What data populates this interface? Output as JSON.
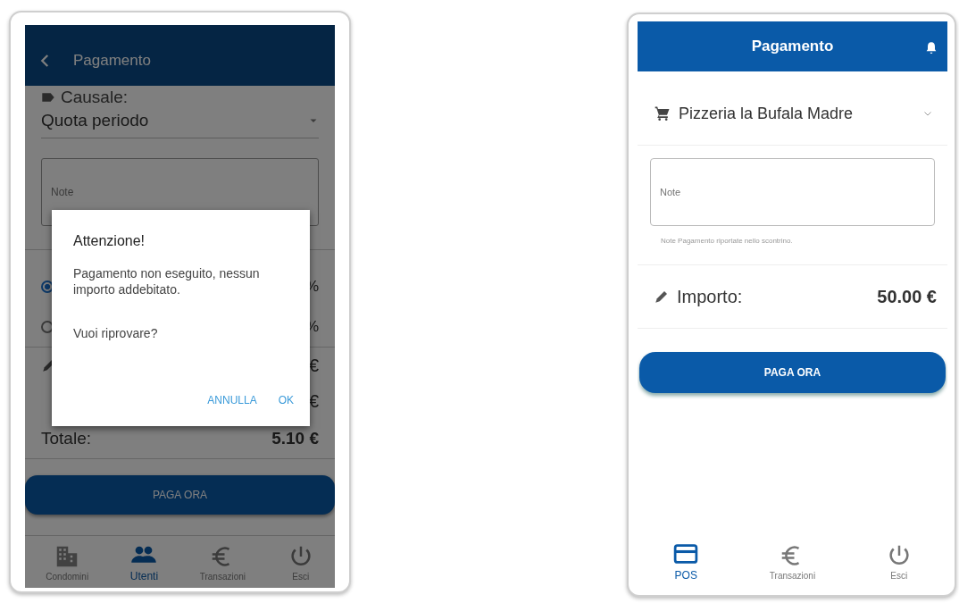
{
  "left_screen": {
    "header": {
      "title": "Pagamento"
    },
    "causale": {
      "label": "Causale:",
      "value": "Quota periodo"
    },
    "note": {
      "placeholder": "Note"
    },
    "options": [
      {
        "selected": true,
        "value": "%"
      },
      {
        "selected": false,
        "value": "%"
      }
    ],
    "amount_rows": [
      {
        "kind": "edit",
        "value": "€"
      },
      {
        "kind": "plain",
        "value": "€"
      }
    ],
    "total": {
      "label": "Totale:",
      "value": "5.10 €"
    },
    "pay_button": "PAGA ORA",
    "nav": [
      {
        "kind": "building",
        "label": "Condomini",
        "selected": false
      },
      {
        "kind": "users",
        "label": "Utenti",
        "selected": true
      },
      {
        "kind": "euro",
        "label": "Transazioni",
        "selected": false
      },
      {
        "kind": "power",
        "label": "Esci",
        "selected": false
      }
    ],
    "dialog": {
      "title": "Attenzione!",
      "message": "Pagamento non eseguito, nessun importo addebitato.",
      "question": "Vuoi riprovare?",
      "buttons": [
        "ANNULLA",
        "OK"
      ]
    }
  },
  "right_screen": {
    "header": {
      "title": "Pagamento"
    },
    "merchant": "Pizzeria la Bufala Madre",
    "note": {
      "placeholder": "Note",
      "helper": "Note Pagamento riportate nello scontrino."
    },
    "amount": {
      "label": "Importo:",
      "value": "50.00 €"
    },
    "pay_button": "PAGA ORA",
    "nav": [
      {
        "kind": "card",
        "label": "POS",
        "selected": true
      },
      {
        "kind": "euro",
        "label": "Transazioni",
        "selected": false
      },
      {
        "kind": "power",
        "label": "Esci",
        "selected": false
      }
    ]
  }
}
